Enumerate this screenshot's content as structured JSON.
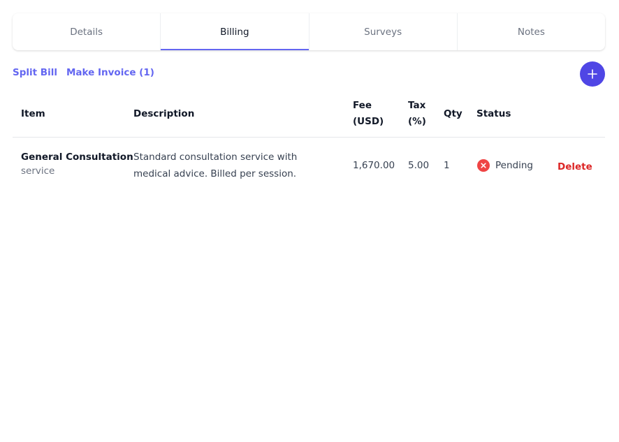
{
  "tabs": [
    {
      "label": "Details",
      "active": false
    },
    {
      "label": "Billing",
      "active": true
    },
    {
      "label": "Surveys",
      "active": false
    },
    {
      "label": "Notes",
      "active": false
    }
  ],
  "actions": {
    "split_bill": "Split Bill",
    "make_invoice": "Make Invoice (1)"
  },
  "table": {
    "headers": {
      "item": "Item",
      "description": "Description",
      "fee_line1": "Fee",
      "fee_line2": "(USD)",
      "tax_line1": "Tax",
      "tax_line2": "(%)",
      "qty": "Qty",
      "status": "Status"
    },
    "rows": [
      {
        "item": "General Consultation",
        "type": "service",
        "description": "Standard consultation service with medical advice. Billed per session.",
        "fee": "1,670.00",
        "tax": "5.00",
        "qty": "1",
        "status": "Pending",
        "delete": "Delete"
      }
    ]
  },
  "colors": {
    "accent": "#6366f1",
    "fab": "#4f46e5",
    "danger": "#dc2626",
    "status_pending": "#ef4444"
  },
  "icons": {
    "fab": "plus-icon",
    "status": "x-circle-icon"
  }
}
